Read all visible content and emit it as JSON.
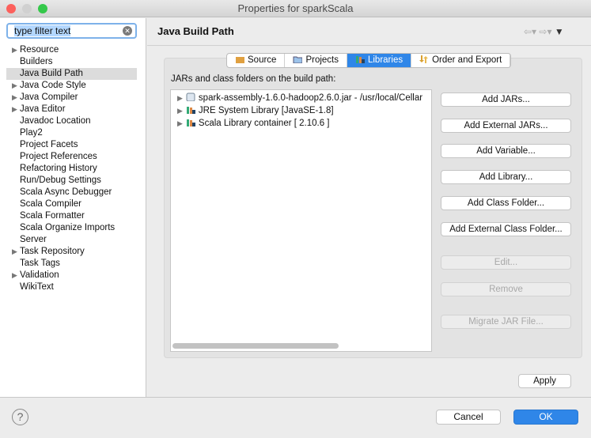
{
  "window": {
    "title": "Properties for sparkScala"
  },
  "filter": {
    "value": "type filter text"
  },
  "sidebar": {
    "items": [
      {
        "label": "Resource",
        "expandable": true
      },
      {
        "label": "Builders"
      },
      {
        "label": "Java Build Path",
        "selected": true
      },
      {
        "label": "Java Code Style",
        "expandable": true
      },
      {
        "label": "Java Compiler",
        "expandable": true
      },
      {
        "label": "Java Editor",
        "expandable": true
      },
      {
        "label": "Javadoc Location"
      },
      {
        "label": "Play2"
      },
      {
        "label": "Project Facets"
      },
      {
        "label": "Project References"
      },
      {
        "label": "Refactoring History"
      },
      {
        "label": "Run/Debug Settings"
      },
      {
        "label": "Scala Async Debugger"
      },
      {
        "label": "Scala Compiler"
      },
      {
        "label": "Scala Formatter"
      },
      {
        "label": "Scala Organize Imports"
      },
      {
        "label": "Server"
      },
      {
        "label": "Task Repository",
        "expandable": true
      },
      {
        "label": "Task Tags"
      },
      {
        "label": "Validation",
        "expandable": true
      },
      {
        "label": "WikiText"
      }
    ]
  },
  "header": {
    "title": "Java Build Path"
  },
  "tabs": [
    {
      "label": "Source",
      "icon": "source-folder-icon"
    },
    {
      "label": "Projects",
      "icon": "folder-icon"
    },
    {
      "label": "Libraries",
      "icon": "library-icon",
      "active": true
    },
    {
      "label": "Order and Export",
      "icon": "order-export-icon"
    }
  ],
  "list_label": "JARs and class folders on the build path:",
  "entries": [
    {
      "label": "spark-assembly-1.6.0-hadoop2.6.0.jar - /usr/local/Cellar",
      "icon": "jar-icon"
    },
    {
      "label": "JRE System Library [JavaSE-1.8]",
      "icon": "library-icon"
    },
    {
      "label": "Scala Library container [ 2.10.6 ]",
      "icon": "library-icon"
    }
  ],
  "buttons": [
    {
      "label": "Add JARs...",
      "enabled": true
    },
    {
      "label": "Add External JARs...",
      "enabled": true
    },
    {
      "label": "Add Variable...",
      "enabled": true
    },
    {
      "label": "Add Library...",
      "enabled": true
    },
    {
      "label": "Add Class Folder...",
      "enabled": true
    },
    {
      "label": "Add External Class Folder...",
      "enabled": true
    },
    {
      "label": "Edit...",
      "enabled": false
    },
    {
      "label": "Remove",
      "enabled": false
    },
    {
      "label": "Migrate JAR File...",
      "enabled": false
    }
  ],
  "apply": "Apply",
  "cancel": "Cancel",
  "ok": "OK",
  "colors": {
    "accent": "#2f86e8"
  }
}
